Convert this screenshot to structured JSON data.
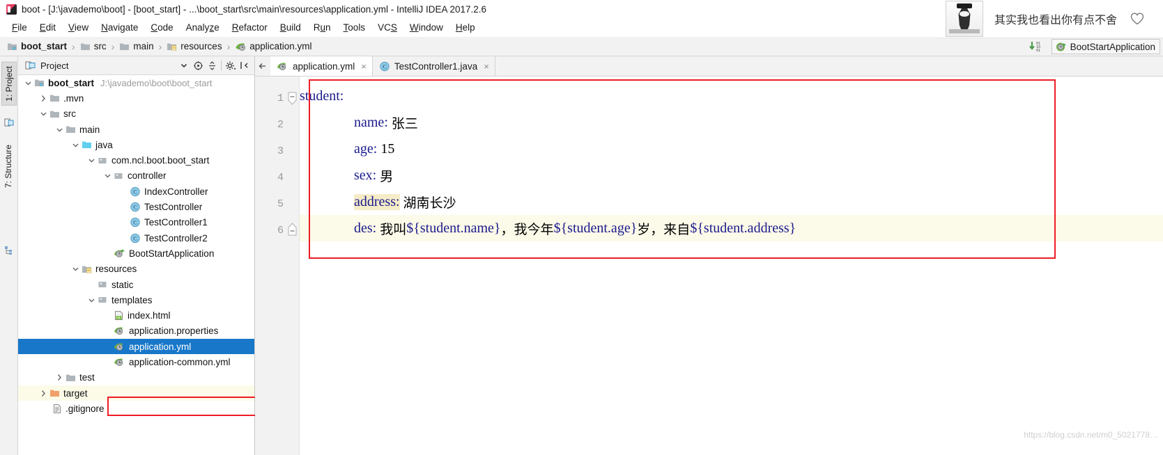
{
  "window": {
    "title": "boot - [J:\\javademo\\boot] - [boot_start] - ...\\boot_start\\src\\main\\resources\\application.yml - IntelliJ IDEA 2017.2.6",
    "app_icon": "intellij-idea-icon"
  },
  "menubar": {
    "items": [
      {
        "label": "File",
        "mnemonic": "F",
        "rest": "ile"
      },
      {
        "label": "Edit",
        "mnemonic": "E",
        "rest": "dit"
      },
      {
        "label": "View",
        "mnemonic": "V",
        "rest": "iew"
      },
      {
        "label": "Navigate",
        "mnemonic": "N",
        "rest": "avigate"
      },
      {
        "label": "Code",
        "mnemonic": "C",
        "rest": "ode"
      },
      {
        "label": "Analyze",
        "pre": "Analy",
        "mnemonic": "z",
        "rest": "e"
      },
      {
        "label": "Refactor",
        "mnemonic": "R",
        "rest": "efactor"
      },
      {
        "label": "Build",
        "mnemonic": "B",
        "rest": "uild"
      },
      {
        "label": "Run",
        "pre": "R",
        "mnemonic": "u",
        "rest": "n"
      },
      {
        "label": "Tools",
        "mnemonic": "T",
        "rest": "ools"
      },
      {
        "label": "VCS",
        "pre": "VC",
        "mnemonic": "S",
        "rest": ""
      },
      {
        "label": "Window",
        "mnemonic": "W",
        "rest": "indow"
      },
      {
        "label": "Help",
        "mnemonic": "H",
        "rest": "elp"
      }
    ]
  },
  "navbar": {
    "crumbs": [
      {
        "label": "boot_start",
        "icon": "module-folder-icon",
        "bold": true
      },
      {
        "label": "src",
        "icon": "folder-icon",
        "bold": false
      },
      {
        "label": "main",
        "icon": "folder-icon",
        "bold": false
      },
      {
        "label": "resources",
        "icon": "resources-folder-icon",
        "bold": false
      },
      {
        "label": "application.yml",
        "icon": "spring-yml-icon",
        "bold": false
      }
    ],
    "separator": "›",
    "update_icon": "update-project-icon",
    "run_config": {
      "label": "BootStartApplication",
      "icon": "spring-boot-run-icon"
    }
  },
  "toolstrip": {
    "tabs": [
      {
        "label": "1: Project",
        "icon": "project-icon",
        "selected": true
      },
      {
        "label": "7: Structure",
        "icon": "structure-icon",
        "selected": false
      }
    ]
  },
  "project_panel": {
    "title": "Project",
    "title_icon": "project-view-icon",
    "buttons": [
      {
        "name": "scope-chooser-dropdown",
        "icon": "chevron-down-icon"
      },
      {
        "name": "locate-in-tree-button",
        "icon": "target-icon"
      },
      {
        "name": "collapse-all-button",
        "icon": "collapse-all-icon"
      },
      {
        "name": "settings-button",
        "icon": "gear-icon"
      },
      {
        "name": "hide-button",
        "icon": "hide-panel-icon"
      }
    ],
    "tree": [
      {
        "label": "boot_start",
        "path": "J:\\javademo\\boot\\boot_start",
        "icon": "module-folder-icon",
        "indent": 0,
        "twisty": "down",
        "bold": true
      },
      {
        "label": ".mvn",
        "icon": "folder-icon",
        "indent": 1,
        "twisty": "right"
      },
      {
        "label": "src",
        "icon": "folder-icon",
        "indent": 1,
        "twisty": "down"
      },
      {
        "label": "main",
        "icon": "folder-icon",
        "indent": 2,
        "twisty": "down"
      },
      {
        "label": "java",
        "icon": "source-folder-icon",
        "indent": 3,
        "twisty": "down"
      },
      {
        "label": "com.ncl.boot.boot_start",
        "icon": "package-icon",
        "indent": 4,
        "twisty": "down"
      },
      {
        "label": "controller",
        "icon": "package-icon",
        "indent": 5,
        "twisty": "down"
      },
      {
        "label": "IndexController",
        "icon": "java-class-icon",
        "indent": 6,
        "twisty": "none"
      },
      {
        "label": "TestController",
        "icon": "java-class-icon",
        "indent": 6,
        "twisty": "none"
      },
      {
        "label": "TestController1",
        "icon": "java-class-icon",
        "indent": 6,
        "twisty": "none"
      },
      {
        "label": "TestController2",
        "icon": "java-class-icon",
        "indent": 6,
        "twisty": "none"
      },
      {
        "label": "BootStartApplication",
        "icon": "spring-boot-run-icon",
        "indent": 5,
        "twisty": "none"
      },
      {
        "label": "resources",
        "icon": "resources-folder-icon",
        "indent": 3,
        "twisty": "down"
      },
      {
        "label": "static",
        "icon": "package-icon",
        "indent": 4,
        "twisty": "none"
      },
      {
        "label": "templates",
        "icon": "package-icon",
        "indent": 4,
        "twisty": "down"
      },
      {
        "label": "index.html",
        "icon": "html-file-icon",
        "indent": 5,
        "twisty": "none"
      },
      {
        "label": "application.properties",
        "icon": "spring-properties-icon",
        "indent": 5,
        "twisty": "none"
      },
      {
        "label": "application.yml",
        "icon": "spring-yml-icon",
        "indent": 5,
        "twisty": "none",
        "selected": true
      },
      {
        "label": "application-common.yml",
        "icon": "spring-yml-icon",
        "indent": 5,
        "twisty": "none"
      },
      {
        "label": "test",
        "icon": "folder-icon",
        "indent": 2,
        "twisty": "right"
      },
      {
        "label": "target",
        "icon": "target-folder-icon",
        "indent": 1,
        "twisty": "right",
        "tinted": true
      },
      {
        "label": ".gitignore",
        "icon": "text-file-icon",
        "indent": 1,
        "twisty": "none"
      }
    ]
  },
  "editor": {
    "back_icon": "arrow-left-icon",
    "tabs": [
      {
        "label": "application.yml",
        "icon": "spring-yml-icon",
        "active": true,
        "close": "×"
      },
      {
        "label": "TestController1.java",
        "icon": "java-class-icon",
        "active": false,
        "close": "×"
      }
    ],
    "line_numbers": [
      "1",
      "2",
      "3",
      "4",
      "5",
      "6"
    ],
    "code_lines": [
      {
        "n": 1,
        "indent": 0,
        "key": "student",
        "colon": ":",
        "value": "",
        "fold": true
      },
      {
        "n": 2,
        "indent": 1,
        "key": "name",
        "colon": ":",
        "value": "张三",
        "cjk": true
      },
      {
        "n": 3,
        "indent": 1,
        "key": "age",
        "colon": ":",
        "value": "15"
      },
      {
        "n": 4,
        "indent": 1,
        "key": "sex",
        "colon": ":",
        "value": "男",
        "cjk": true
      },
      {
        "n": 5,
        "indent": 1,
        "key": "address",
        "colon": ":",
        "value": "湖南长沙",
        "cjk": true,
        "key_highlight": true
      },
      {
        "n": 6,
        "indent": 1,
        "key": "des",
        "colon": ":",
        "current_line": true,
        "segments": [
          {
            "t": "我叫",
            "cjk": true
          },
          {
            "t": "${student.name}",
            "code": true
          },
          {
            "t": "，我今年",
            "cjk": true
          },
          {
            "t": "${student.age}",
            "code": true
          },
          {
            "t": "岁，来自",
            "cjk": true
          },
          {
            "t": "${student.address}",
            "code": true
          }
        ]
      }
    ]
  },
  "overlay": {
    "text": "其实我也看出你有点不舍",
    "thumb_icon": "person-silhouette-thumbnail",
    "heart_icon": "heart-outline-icon"
  },
  "watermark": {
    "text": "https://blog.csdn.net/m0_5021778…"
  },
  "colors": {
    "selection_blue": "#1877c9",
    "annotation_red": "#ee1c25",
    "yaml_key_blue": "#1a1a8c",
    "current_line": "#fcfae8",
    "key_highlight": "#f5ecc8",
    "panel_gray": "#f2f2f2"
  }
}
